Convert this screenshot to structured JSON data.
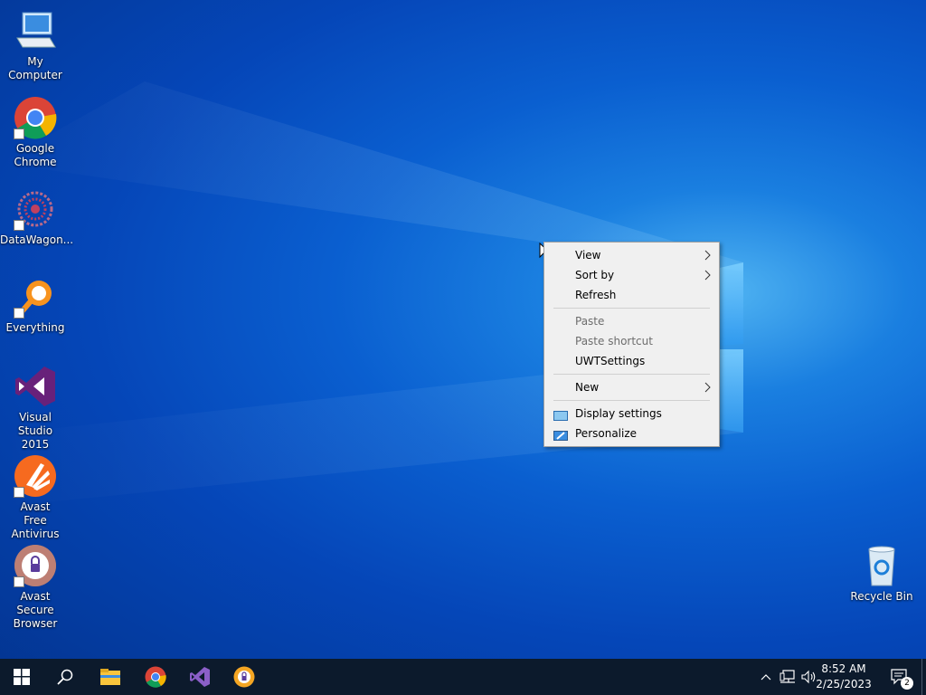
{
  "desktop": {
    "icons": [
      {
        "label": "My Computer",
        "icon": "computer-icon"
      },
      {
        "label": "Google Chrome",
        "icon": "chrome-icon"
      },
      {
        "label": "DataWagon...",
        "icon": "datawagon-icon"
      },
      {
        "label": "Everything",
        "icon": "everything-search-icon"
      },
      {
        "label": "Visual Studio 2015",
        "icon": "visual-studio-icon"
      },
      {
        "label": "Avast Free Antivirus",
        "icon": "avast-antivirus-icon"
      },
      {
        "label": "Avast Secure Browser",
        "icon": "avast-browser-icon"
      }
    ],
    "recycle_bin": {
      "label": "Recycle Bin",
      "icon": "recycle-bin-icon"
    }
  },
  "context_menu": {
    "items": [
      {
        "label": "View",
        "submenu": true,
        "disabled": false
      },
      {
        "label": "Sort by",
        "submenu": true,
        "disabled": false
      },
      {
        "label": "Refresh",
        "submenu": false,
        "disabled": false
      },
      {
        "label": "Paste",
        "submenu": false,
        "disabled": true
      },
      {
        "label": "Paste shortcut",
        "submenu": false,
        "disabled": true
      },
      {
        "label": "UWTSettings",
        "submenu": false,
        "disabled": false
      },
      {
        "label": "New",
        "submenu": true,
        "disabled": false
      },
      {
        "label": "Display settings",
        "submenu": false,
        "disabled": false,
        "icon": "display-settings-icon"
      },
      {
        "label": "Personalize",
        "submenu": false,
        "disabled": false,
        "icon": "personalize-icon"
      }
    ]
  },
  "taskbar": {
    "pinned": [
      "start-icon",
      "search-icon",
      "file-explorer-icon",
      "chrome-icon",
      "visual-studio-icon",
      "avast-browser-icon"
    ],
    "clock": {
      "time": "8:52 AM",
      "date": "2/25/2023"
    },
    "notifications": {
      "count": "2"
    }
  },
  "colors": {
    "taskbar_bg": "#0c1a2c",
    "menu_bg": "#f0f0f0",
    "desktop_accent": "#0a5fd0"
  }
}
